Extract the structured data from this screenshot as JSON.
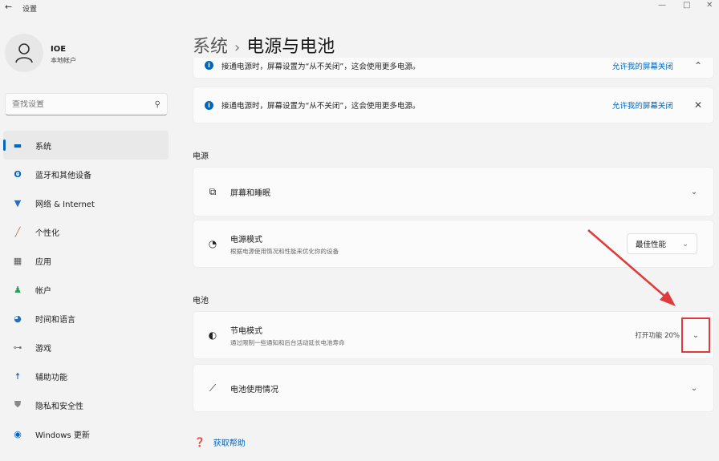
{
  "window": {
    "back_icon": "back-arrow-icon",
    "title": "设置",
    "controls": [
      "—",
      "□",
      "✕"
    ]
  },
  "user": {
    "name": "IOE",
    "account_type": "本地帐户"
  },
  "search": {
    "placeholder": "查找设置"
  },
  "nav": {
    "items": [
      {
        "label": "系统",
        "icon": "monitor-icon",
        "active": true
      },
      {
        "label": "蓝牙和其他设备",
        "icon": "bluetooth-icon"
      },
      {
        "label": "网络 & Internet",
        "icon": "wifi-icon"
      },
      {
        "label": "个性化",
        "icon": "pen-icon"
      },
      {
        "label": "应用",
        "icon": "apps-icon"
      },
      {
        "label": "帐户",
        "icon": "person-icon"
      },
      {
        "label": "时间和语言",
        "icon": "globe-icon"
      },
      {
        "label": "游戏",
        "icon": "gamepad-icon"
      },
      {
        "label": "辅助功能",
        "icon": "accessibility-icon"
      },
      {
        "label": "隐私和安全性",
        "icon": "shield-icon"
      },
      {
        "label": "Windows 更新",
        "icon": "update-icon"
      }
    ]
  },
  "breadcrumb": {
    "parent": "系统",
    "separator": "›",
    "current": "电源与电池"
  },
  "notices": [
    {
      "text": "接通电源时，屏幕设置为“从不关闭”，这会使用更多电源。",
      "link": "允许我的屏幕关闭"
    },
    {
      "text": "接通电源时，屏幕设置为“从不关闭”，这会使用更多电源。",
      "link": "允许我的屏幕关闭",
      "close": "✕"
    }
  ],
  "sections": {
    "power": {
      "label": "电源",
      "screen_sleep": {
        "title": "屏幕和睡眠"
      },
      "power_mode": {
        "title": "电源模式",
        "subtitle": "根据电源使用情况和性能来优化你的设备",
        "value": "最佳性能"
      }
    },
    "battery": {
      "label": "电池",
      "saver": {
        "title": "节电模式",
        "subtitle": "通过限制一些通知和后台活动延长电池寿命",
        "status": "打开功能 20%"
      },
      "usage": {
        "title": "电池使用情况"
      }
    }
  },
  "help": {
    "label": "获取帮助"
  },
  "colors": {
    "accent": "#0067c0",
    "annotation": "#e03a3a"
  }
}
